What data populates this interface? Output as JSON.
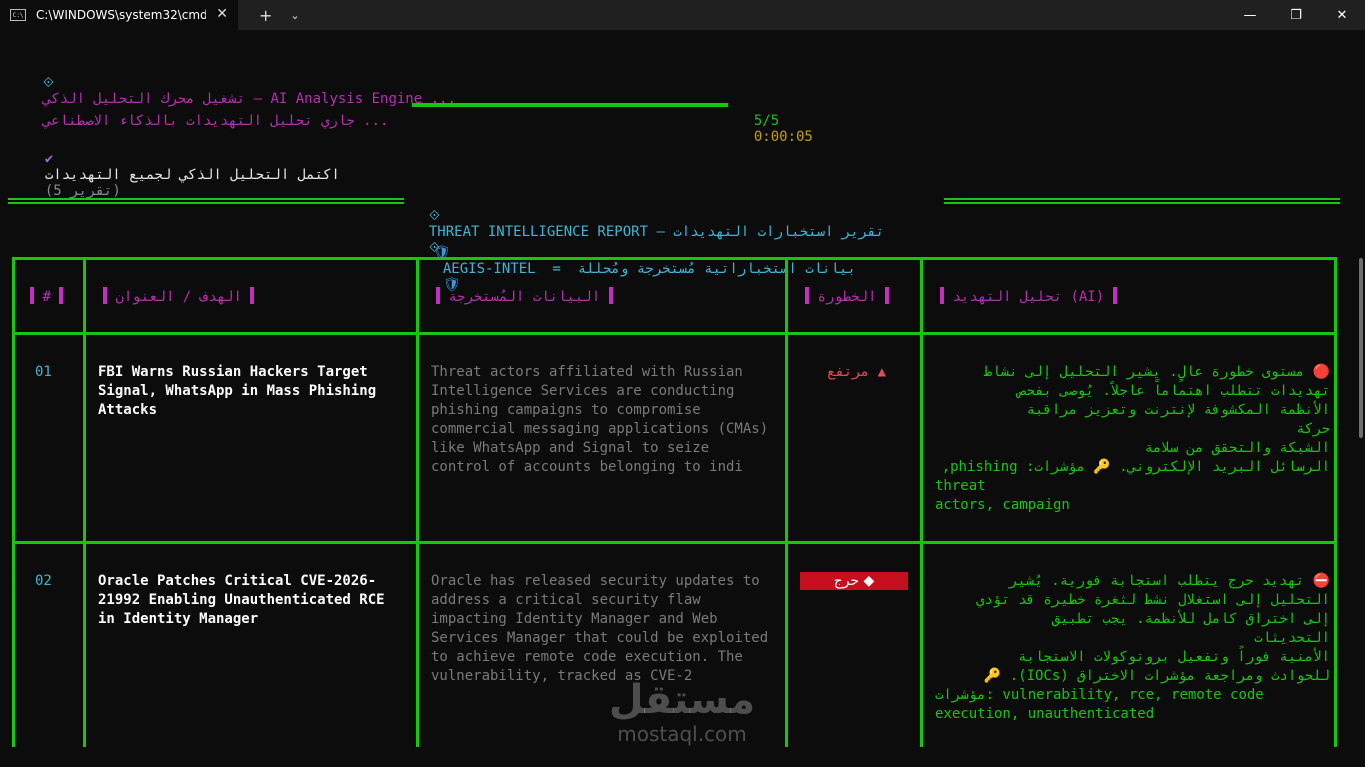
{
  "window": {
    "tab_title": "C:\\WINDOWS\\system32\\cmd.",
    "tab_icon": "C:\\",
    "close_tab": "✕",
    "new_tab": "+",
    "dropdown": "⌄",
    "minimize": "—",
    "maximize": "❐",
    "close": "✕"
  },
  "console": {
    "line1_icon": "⟐",
    "line1_text": "تشغيل محرك التحليل الذكي – AI Analysis Engine ...",
    "line2_text": "جاري تحليل التهديدات بالذكاء الاصطناعي ...",
    "progress_count": "5/5",
    "progress_time": "0:00:05",
    "progress_value": 1.0,
    "line3_icon": "✔",
    "line3_text": "اكتمل التحليل الذكي لجميع التهديدات",
    "line3_count": "(5 تقرير)"
  },
  "report": {
    "title_icon_left": "⟐",
    "title": "THREAT INTELLIGENCE REPORT — تقرير استخبارات التهديدات",
    "title_icon_right": "⟐",
    "subtitle_icon": "🛡",
    "subtitle": "AEGIS-INTEL  =  بيانات استخباراتية مُستخرجة ومُحللة"
  },
  "table": {
    "headers": {
      "num": "#",
      "event": "الهدف / العنوان",
      "desc": "البيانات المُستخرجة",
      "risk": "الخطورة",
      "analysis": "تحليل التهديد (AI)"
    },
    "rows": [
      {
        "num": "01",
        "event": "FBI Warns Russian Hackers Target Signal, WhatsApp in Mass Phishing Attacks",
        "desc": "Threat actors affiliated with Russian Intelligence Services are conducting phishing campaigns to compromise commercial messaging applications (CMAs) like WhatsApp and Signal to seize control of accounts belonging to indi",
        "risk": "مرتفع ▲",
        "analysis_lines": [
          "🔴 مستوى خطورة عالٍ. يشير التحليل إلى نشاط",
          "تهديدات تتطلب اهتماماً عاجلاً. يُوصى بفحص",
          "الأنظمة المكشوفة لإنترنت وتعزيز مراقبة",
          "حركة",
          "الشبكة والتحقق من سلامة",
          "الرسائل البريد الإلكتروني. 🔑 مؤشرات: phishing,",
          "threat",
          "actors, campaign"
        ]
      },
      {
        "num": "02",
        "event": "Oracle Patches Critical CVE-2026-21992 Enabling Unauthenticated RCE in Identity Manager",
        "desc": "Oracle has released  security updates to address a critical security flaw impacting Identity Manager and Web Services Manager that could be exploited to achieve remote code execution.  The vulnerability, tracked as CVE-2",
        "risk": "حرج ◆",
        "analysis_lines": [
          "⛔ تهديد حرج يتطلب استجابة فورية. يُشير",
          "التحليل إلى استغلال نشط لثغرة خطيرة قد تؤدي",
          "إلى اختراق كامل للأنظمة. يجب تطبيق",
          "التحديثات",
          "الأمنية فوراً وتفعيل بروتوكولات الاستجابة",
          "للحوادث ومراجعة مؤشرات الاختراق (IOCs). 🔑",
          "مؤشرات: vulnerability, rce, remote code",
          "execution, unauthenticated"
        ]
      }
    ]
  },
  "watermark": {
    "arabic": "مستقل",
    "latin": "mostaql.com"
  }
}
